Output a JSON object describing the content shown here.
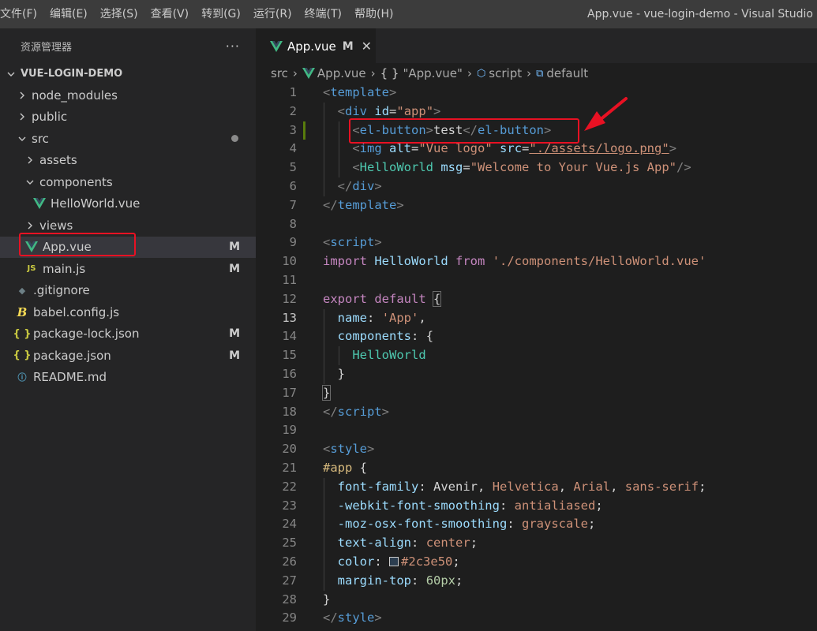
{
  "menu": {
    "items": [
      "文件(F)",
      "编辑(E)",
      "选择(S)",
      "查看(V)",
      "转到(G)",
      "运行(R)",
      "终端(T)",
      "帮助(H)"
    ]
  },
  "window": {
    "title": "App.vue - vue-login-demo - Visual Studio Code"
  },
  "explorer": {
    "title": "资源管理器",
    "more": "···",
    "project": "VUE-LOGIN-DEMO",
    "items": [
      {
        "label": "node_modules",
        "badge": ""
      },
      {
        "label": "public",
        "badge": ""
      },
      {
        "label": "src",
        "badge": ""
      },
      {
        "label": "assets",
        "badge": ""
      },
      {
        "label": "components",
        "badge": ""
      },
      {
        "label": "HelloWorld.vue",
        "badge": ""
      },
      {
        "label": "views",
        "badge": ""
      },
      {
        "label": "App.vue",
        "badge": "M"
      },
      {
        "label": "main.js",
        "badge": "M"
      },
      {
        "label": ".gitignore",
        "badge": ""
      },
      {
        "label": "babel.config.js",
        "badge": ""
      },
      {
        "label": "package-lock.json",
        "badge": "M"
      },
      {
        "label": "package.json",
        "badge": "M"
      },
      {
        "label": "README.md",
        "badge": ""
      }
    ]
  },
  "tab": {
    "label": "App.vue",
    "badge": "M",
    "close": "✕"
  },
  "breadcrumb": {
    "src": "src",
    "file": "App.vue",
    "scope": "\"App.vue\"",
    "script": "script",
    "default": "default"
  },
  "icons": {
    "js": "JS",
    "json": "{ }",
    "babel": "B",
    "info": "ⓘ",
    "git": "◆",
    "brace": "{ }"
  },
  "colors": {
    "accent_red": "#e81123",
    "vue_green": "#41b883",
    "editor_bg": "#1e1e1e",
    "sidebar_bg": "#252526",
    "swatch": "#2c3e50"
  },
  "code": {
    "line_numbers": [
      "1",
      "2",
      "3",
      "4",
      "5",
      "6",
      "7",
      "8",
      "9",
      "10",
      "11",
      "12",
      "13",
      "14",
      "15",
      "16",
      "17",
      "18",
      "19",
      "20",
      "21",
      "22",
      "23",
      "24",
      "25",
      "26",
      "27",
      "28",
      "29"
    ],
    "l1": [
      "<",
      "template",
      ">"
    ],
    "l2": [
      "<",
      "div",
      "id",
      "=",
      "\"app\"",
      ">"
    ],
    "l3": [
      "<",
      "el-button",
      ">",
      "test",
      "</",
      "el-button",
      ">"
    ],
    "l4": [
      "<",
      "img",
      "alt",
      "=",
      "\"Vue logo\"",
      "src",
      "=",
      "\"./assets/logo.png\"",
      ">"
    ],
    "l5": [
      "<",
      "HelloWorld",
      "msg",
      "=",
      "\"Welcome to Your Vue.js App\"",
      "/>"
    ],
    "l6": [
      "</",
      "div",
      ">"
    ],
    "l7": [
      "</",
      "template",
      ">"
    ],
    "l9": [
      "<",
      "script",
      ">"
    ],
    "l10": [
      "import",
      "HelloWorld",
      "from",
      "'./components/HelloWorld.vue'"
    ],
    "l12": [
      "export",
      "default",
      "{"
    ],
    "l13": [
      "name",
      ":",
      "'App'",
      ","
    ],
    "l14": [
      "components",
      ":",
      "{"
    ],
    "l15": [
      "HelloWorld"
    ],
    "l16": [
      "}"
    ],
    "l17": [
      "}"
    ],
    "l18": [
      "</",
      "script",
      ">"
    ],
    "l20": [
      "<",
      "style",
      ">"
    ],
    "l21": [
      "#app",
      "{"
    ],
    "l22": [
      "font-family",
      ":",
      "Avenir",
      ",",
      "Helvetica",
      ",",
      "Arial",
      ",",
      "sans-serif",
      ";"
    ],
    "l23": [
      "-webkit-font-smoothing",
      ":",
      "antialiased",
      ";"
    ],
    "l24": [
      "-moz-osx-font-smoothing",
      ":",
      "grayscale",
      ";"
    ],
    "l25": [
      "text-align",
      ":",
      "center",
      ";"
    ],
    "l26": [
      "color",
      ":",
      "#2c3e50",
      ";"
    ],
    "l27": [
      "margin-top",
      ":",
      "60px",
      ";"
    ],
    "l28": [
      "}"
    ],
    "l29": [
      "</",
      "style",
      ">"
    ]
  }
}
